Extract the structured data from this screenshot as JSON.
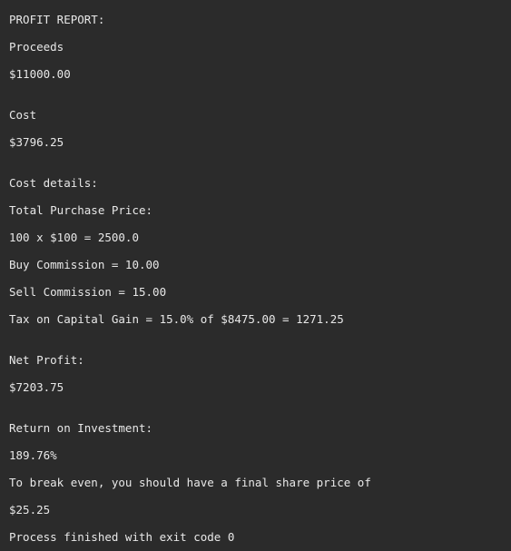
{
  "console": {
    "lines": [
      "PROFIT REPORT:",
      "Proceeds",
      "$11000.00",
      "Cost",
      "$3796.25",
      "Cost details:",
      "Total Purchase Price:",
      "100 x $100 = 2500.0",
      "Buy Commission = 10.00",
      "Sell Commission = 15.00",
      "Tax on Capital Gain = 15.0% of $8475.00 = 1271.25",
      "Net Profit:",
      "$7203.75",
      "Return on Investment:",
      "189.76%",
      "To break even, you should have a final share price of",
      "$25.25",
      "Process finished with exit code 0"
    ]
  }
}
